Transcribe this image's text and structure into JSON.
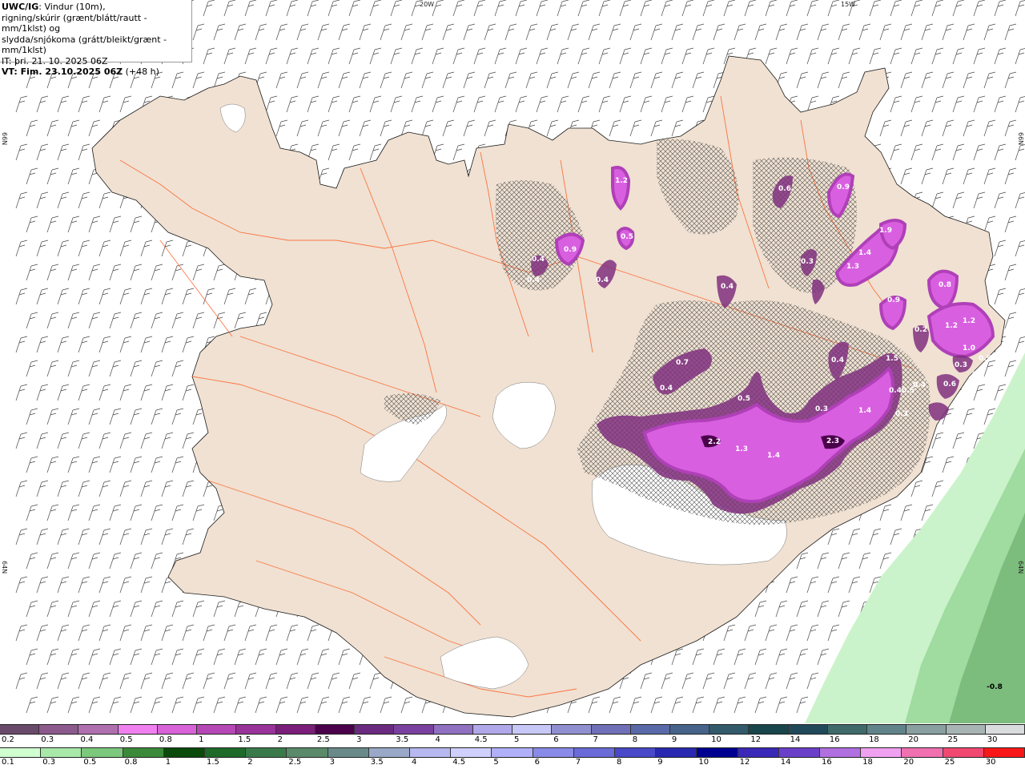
{
  "header": {
    "model": "UWC/IG",
    "title_rest": ": Vindur (10m),",
    "line2": "rigning/skúrir (grænt/blátt/rautt - mm/1klst) og",
    "line3": "slydda/snjókoma (grátt/bleikt/grænt - mm/1klst)",
    "it": "IT: þri. 21. 10. 2025 06Z",
    "vt_bold": "VT: Fim. 23.10.2025 06Z",
    "vt_rest": " (+48 h)"
  },
  "grid_labels": {
    "top_20w": "20W",
    "top_15w": "15W",
    "left_66n": "66N",
    "right_66n": "66N",
    "left_64n": "64N",
    "right_64n": "64N"
  },
  "map_labels": [
    {
      "text": "1.2"
    },
    {
      "text": "0.6"
    },
    {
      "text": "0.9"
    },
    {
      "text": "0.5"
    },
    {
      "text": "0.4"
    },
    {
      "text": "0.9"
    },
    {
      "text": "0.4"
    },
    {
      "text": "0.4"
    },
    {
      "text": "1.9"
    },
    {
      "text": "1.4"
    },
    {
      "text": "0.3"
    },
    {
      "text": "1.3"
    },
    {
      "text": "0.4"
    },
    {
      "text": "0.8"
    },
    {
      "text": "0.9"
    },
    {
      "text": "1.2"
    },
    {
      "text": "1.2"
    },
    {
      "text": "0.2"
    },
    {
      "text": "1.0"
    },
    {
      "text": "0.5"
    },
    {
      "text": "0.3"
    },
    {
      "text": "0.5"
    },
    {
      "text": "0.4"
    },
    {
      "text": "0.6"
    },
    {
      "text": "1.5"
    },
    {
      "text": "0.4"
    },
    {
      "text": "0.7"
    },
    {
      "text": "0.3"
    },
    {
      "text": "0.5"
    },
    {
      "text": "0.5"
    },
    {
      "text": "0.4"
    },
    {
      "text": "0.3"
    },
    {
      "text": "2.3"
    },
    {
      "text": "0.4"
    },
    {
      "text": "1.4"
    },
    {
      "text": "2.2"
    },
    {
      "text": "1.3"
    },
    {
      "text": "1.4"
    },
    {
      "text": "-0.8"
    }
  ],
  "legend_snow": {
    "labels": [
      "0.2",
      "0.3",
      "0.4",
      "0.5",
      "0.8",
      "1",
      "1.5",
      "2",
      "2.5",
      "3",
      "3.5",
      "4",
      "4.5",
      "5",
      "6",
      "7",
      "8",
      "9",
      "10",
      "12",
      "14",
      "16",
      "18",
      "20",
      "25",
      "30"
    ],
    "colors": [
      "#6a4a6a",
      "#8c5a8c",
      "#b070b0",
      "#f080f0",
      "#d862d8",
      "#b648b6",
      "#993399",
      "#7a1e7a",
      "#4b004b",
      "#6a2a80",
      "#7a40a0",
      "#9070c0",
      "#b0a8e8",
      "#c8c8f8",
      "#9090d0",
      "#7070b8",
      "#5a6aa8",
      "#46648a",
      "#325a6a",
      "#18464a",
      "#204a5a",
      "#406a6a",
      "#60848a",
      "#8aa0a0",
      "#a8b4b4",
      "#d8dcdc"
    ]
  },
  "legend_rain": {
    "labels": [
      "0.1",
      "0.3",
      "0.5",
      "0.8",
      "1",
      "1.5",
      "2",
      "2.5",
      "3",
      "3.5",
      "4",
      "4.5",
      "5",
      "6",
      "7",
      "8",
      "9",
      "10",
      "12",
      "14",
      "16",
      "18",
      "20",
      "25",
      "30"
    ],
    "colors": [
      "#d0ffd0",
      "#a8e8a8",
      "#7cc87c",
      "#3a8a3a",
      "#0a4a0a",
      "#1e6a2a",
      "#3a7a4a",
      "#5a8a6a",
      "#6a8a8a",
      "#9aa8c8",
      "#b8b8f0",
      "#d0d0ff",
      "#b0b0f8",
      "#8a8ae8",
      "#6a6ad8",
      "#4848c8",
      "#2828b0",
      "#000090",
      "#3a28b8",
      "#6a40c8",
      "#b070e0",
      "#f0a0f0",
      "#f070b0",
      "#f04870",
      "#f81818"
    ]
  },
  "colors": {
    "land": "#f0e1d2",
    "sea": "#ffffff",
    "coast": "#1a1a1a",
    "roads": "#ff5a1e",
    "rivers": "#5a5aff",
    "glacier": "#ffffff",
    "purple_light": "#d860e0",
    "purple_mid": "#b040b8",
    "purple_dark": "#80307f",
    "rain_light": "#cbf3cb",
    "rain_mid": "#a0dba0",
    "rain_dark": "#7cbc7c",
    "barbs": "#4a4a4a"
  }
}
